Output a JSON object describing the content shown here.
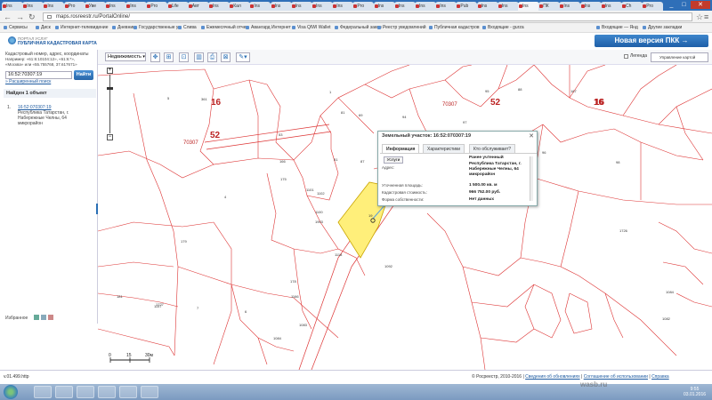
{
  "browser": {
    "tabs": [
      "Ins",
      "Ins",
      "Ins",
      "Pro",
      "Уве",
      "Ins",
      "Ins",
      "Pro",
      "Life",
      "Авт",
      "Ins",
      "Кал",
      "Ins",
      "Ins",
      "Ins",
      "Ins",
      "Ins",
      "Pro",
      "Ins",
      "Ins",
      "Ins",
      "Ins",
      "Pub",
      "Ins",
      "Ins",
      "Ins",
      "ПК",
      "Ins",
      "Ins",
      "Ins",
      "Ch",
      "Pro"
    ],
    "url": "maps.rosreestr.ru/PortalOnline/",
    "bookmarks": [
      "Сервисы",
      "Диск",
      "Интернет-телевидение",
      "Дневник",
      "Государственные у",
      "Слива",
      "Ежемесячный отчет",
      "Авангард Интернет",
      "Visa QIWI Wallet",
      "Федеральный закон",
      "Реестр уведомлений",
      "Публичная кадастров",
      "Входящие - gurza",
      "Входящие — Янд",
      "Другие закладки"
    ]
  },
  "site": {
    "logo_top": "ПОРТАЛ УСЛУГ",
    "logo_main": "ПУБЛИЧНАЯ КАДАСТРОВАЯ КАРТА",
    "new_version": "Новая версия ПКК →"
  },
  "left_panel": {
    "hint_title": "Кадастровый номер, адрес, координаты",
    "hint_example1": "Например: «61:6:10104:12», «61:6:*»,",
    "hint_example2": "«Москва» или «55.755768, 37.617671»",
    "search_value": "16:52:70307:19",
    "find_label": "Найти",
    "advanced_search": "» Расширенный поиск",
    "found_label": "Найден 1 объект",
    "result_index": "1.",
    "result_number": "16:52:070307:19",
    "result_addr1": "Республика Татарстан, г.",
    "result_addr2": "Набережные Челны, 64",
    "result_addr3": "микрорайон",
    "favorites": "Избранное"
  },
  "toolbar": {
    "layer_select": "Недвижимость",
    "legend": "Легенда",
    "map_management": "Управление картой"
  },
  "map": {
    "labels": [
      {
        "t": "16",
        "big": true,
        "c": "#b22"
      },
      {
        "t": "52",
        "big": true,
        "c": "#b22"
      },
      {
        "t": "70307",
        "big": false,
        "c": "#b22"
      },
      {
        "t": "16",
        "big": true,
        "c": "#b22"
      },
      {
        "t": "70307",
        "big": false,
        "c": "#b22"
      },
      {
        "t": "52",
        "big": true,
        "c": "#b22"
      },
      {
        "t": "16",
        "big": true,
        "c": "#b22"
      }
    ],
    "parcel_nums": [
      "5",
      "361",
      "81",
      "69",
      "94",
      "97",
      "88",
      "95",
      "167",
      "1",
      "51",
      "99",
      "57",
      "53",
      "166",
      "175",
      "1101",
      "1102",
      "87",
      "4",
      "1100",
      "19",
      "1903",
      "1118",
      "1157",
      "179",
      "1726",
      "96",
      "181",
      "1727",
      "178",
      "1166",
      "7",
      "6",
      "1084",
      "1083",
      "1092",
      "98",
      "1084",
      "1082"
    ],
    "scale_ticks": [
      "0",
      "15",
      "30м"
    ]
  },
  "popup": {
    "title": "Земельный участок: 16:52:070307:19",
    "tabs": [
      "Информация",
      "Характеристики",
      "Кто обслуживает?"
    ],
    "services_btn": "Услуги",
    "status": "Ранее учтенный",
    "address_label": "Адрес:",
    "address_value1": "Республика Татарстан, г.",
    "address_value2": "Набережные Челны, 64",
    "address_value3": "микрорайон",
    "area_label": "Уточненная площадь:",
    "area_value": "1 500.00 кв. м",
    "cost_label": "Кадастровая стоимость:",
    "cost_value": "966 752.00 руб.",
    "ownership_label": "Форма собственности:",
    "ownership_value": "Нет данных"
  },
  "status": {
    "left": "v.01.499.http",
    "copyright": "© Росреестр, 2010-2016 |",
    "link1": "Сведения об обновлениях",
    "link2": "Соглашение об использовании",
    "link3": "Справка"
  },
  "taskbar": {
    "time": "9:55",
    "date": "03.01.2016"
  },
  "watermark": "wasb.ru"
}
